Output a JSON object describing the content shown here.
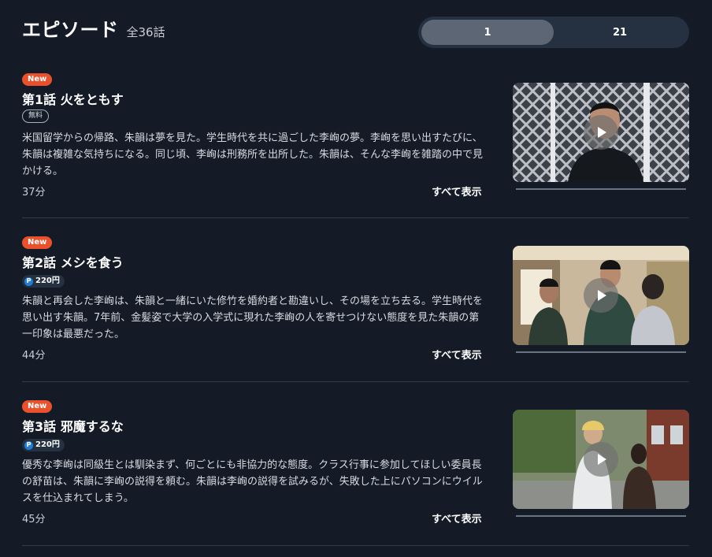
{
  "header": {
    "title": "エピソード",
    "count": "全36話"
  },
  "pager": {
    "tabs": [
      "1",
      "21"
    ],
    "active_index": 0
  },
  "episodes": [
    {
      "badge": "New",
      "title": "第1話 火をともす",
      "tag": "無料",
      "description": "米国留学からの帰路、朱韻は夢を見た。学生時代を共に過ごした李峋の夢。李峋を思い出すたびに、朱韻は複雑な気持ちになる。同じ頃、李峋は刑務所を出所した。朱韻は、そんな李峋を雑踏の中で見かける。",
      "duration": "37分",
      "show_all": "すべて表示"
    },
    {
      "badge": "New",
      "title": "第2話 メシを食う",
      "price_icon": "P",
      "price": "220円",
      "description": "朱韻と再会した李峋は、朱韻と一緒にいた修竹を婚約者と勘違いし、その場を立ち去る。学生時代を思い出す朱韻。7年前、金髪姿で大学の入学式に現れた李峋の人を寄せつけない態度を見た朱韻の第一印象は最悪だった。",
      "duration": "44分",
      "show_all": "すべて表示"
    },
    {
      "badge": "New",
      "title": "第3話 邪魔するな",
      "price_icon": "P",
      "price": "220円",
      "description": "優秀な李峋は同級生とは馴染まず、何ごとにも非協力的な態度。クラス行事に参加してほしい委員長の舒苗は、朱韻に李峋の説得を頼む。朱韻は李峋の説得を試みるが、失敗した上にパソコンにウイルスを仕込まれてしまう。",
      "duration": "45分",
      "show_all": "すべて表示"
    }
  ],
  "colors": {
    "background": "#141b26",
    "new_badge": "#e8512b",
    "point_icon": "#1e7fd9",
    "pager_bg": "#253040",
    "pager_active": "#5d6675"
  },
  "icons": {
    "play": "play-icon",
    "point": "point-coin-icon"
  }
}
